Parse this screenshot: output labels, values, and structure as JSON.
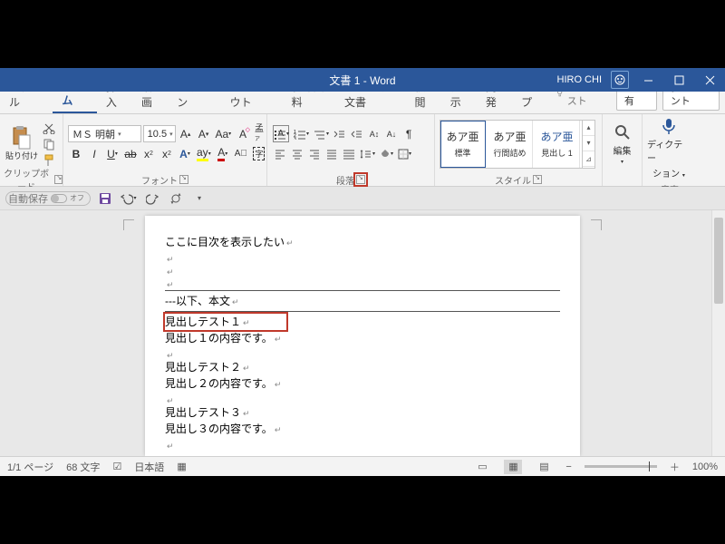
{
  "title": "文書 1 - Word",
  "user": "HIRO CHI",
  "tabs": [
    "ファイル",
    "ホーム",
    "挿入",
    "描画",
    "デザイン",
    "レイアウト",
    "参考資料",
    "差し込み文書",
    "校閲",
    "表示",
    "開発",
    "ヘルプ"
  ],
  "active_tab": 1,
  "search_placeholder": "操作アシスト",
  "share": "共有",
  "comment": "コメント",
  "groups": {
    "clipboard": "クリップボード",
    "font": "フォント",
    "para": "段落",
    "styles": "スタイル",
    "voice": "音声"
  },
  "paste_label": "貼り付け",
  "font_name": "ＭＳ 明朝",
  "font_size": "10.5",
  "styles": [
    {
      "prev": "あア亜",
      "name": "標準",
      "sel": true
    },
    {
      "prev": "あア亜",
      "name": "行間詰め",
      "sel": false
    },
    {
      "prev": "あア亜",
      "name": "見出し 1",
      "sel": false
    }
  ],
  "edit_label": "編集",
  "dictation_l1": "ディクテー",
  "dictation_l2": "ション",
  "autosave": "自動保存",
  "autosave_state": "オフ",
  "doc": {
    "l0": "ここに目次を表示したい",
    "l1": "---以下、本文",
    "l2": "見出しテスト１",
    "l3": "見出し１の内容です。",
    "l4": "見出しテスト２",
    "l5": "見出し２の内容です。",
    "l6": "見出しテスト３",
    "l7": "見出し３の内容です。"
  },
  "status": {
    "page": "1/1 ページ",
    "words": "68 文字",
    "lang": "日本語",
    "zoom": "100%"
  }
}
